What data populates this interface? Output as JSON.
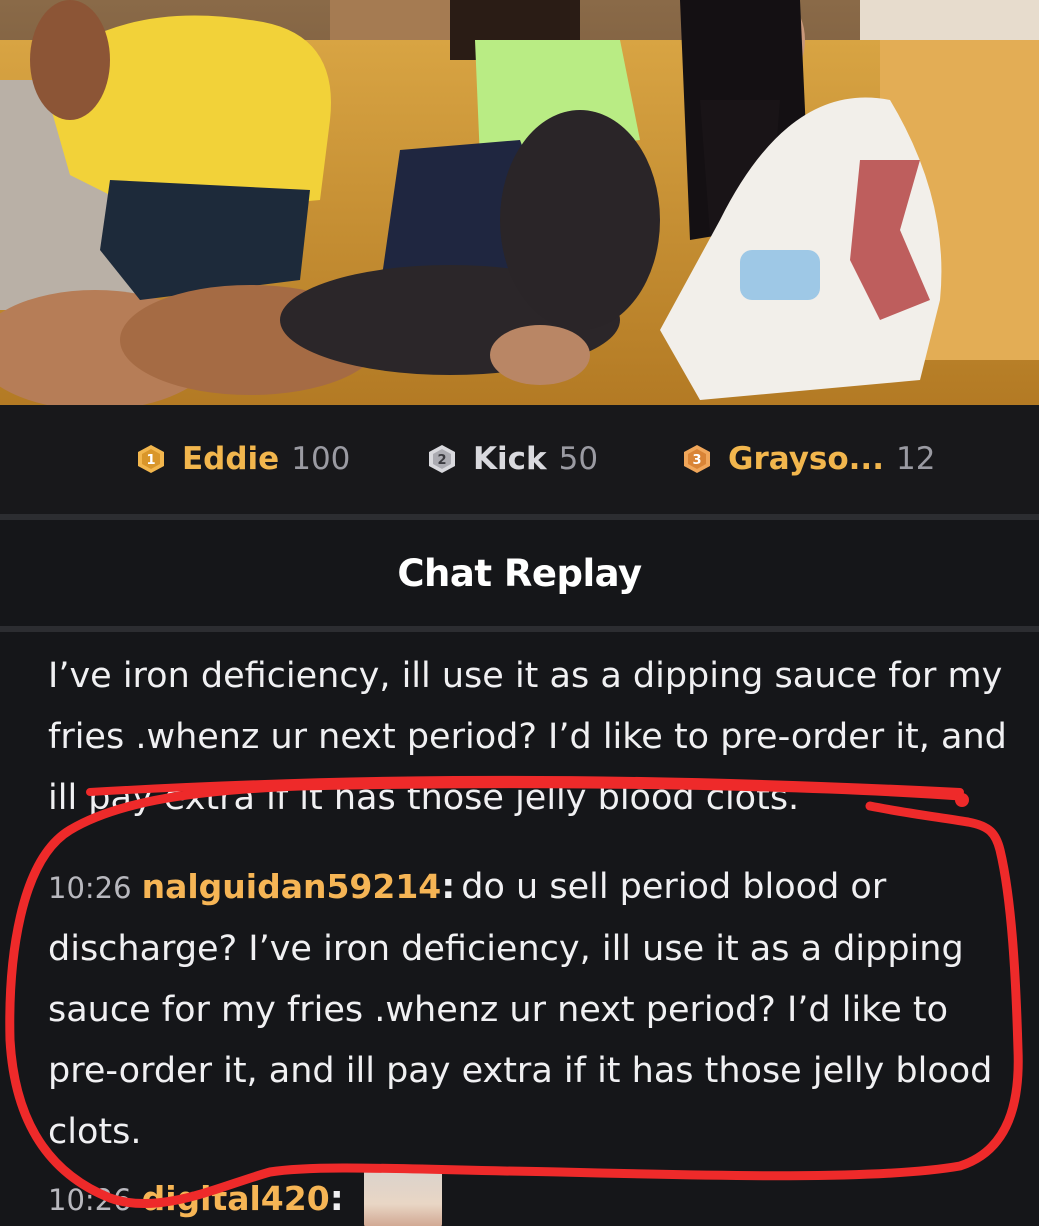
{
  "leaderboard": [
    {
      "rank": "1",
      "name": "Eddie",
      "score": "100",
      "tier": "gold"
    },
    {
      "rank": "2",
      "name": "Kick",
      "score": "50",
      "tier": "silver"
    },
    {
      "rank": "3",
      "name": "Grayso...",
      "score": "12",
      "tier": "bronze"
    }
  ],
  "chat": {
    "title": "Chat Replay",
    "previous_message_tail": "I’ve iron deficiency, ill use it as a dipping sauce for my fries .whenz ur next period? I’d like to pre-order it, and ill pay extra if it has those jelly blood clots.",
    "messages": [
      {
        "time": "10:26",
        "user": "nalguidan59214",
        "text": "do u sell period blood or discharge? I’ve iron deficiency, ill use it as a dipping sauce for my fries .whenz ur next period? I’d like to pre-order it, and ill pay extra if it has those jelly blood clots."
      },
      {
        "time": "10:26",
        "user": "digital420",
        "text": ""
      }
    ]
  },
  "colors": {
    "background": "#151619",
    "username": "#f6b555",
    "gold_rank": "#f2b64d",
    "annotation_red": "#ee2a2a"
  },
  "icons": [
    "rank-1-gold-badge-icon",
    "rank-2-silver-badge-icon",
    "rank-3-bronze-badge-icon"
  ]
}
